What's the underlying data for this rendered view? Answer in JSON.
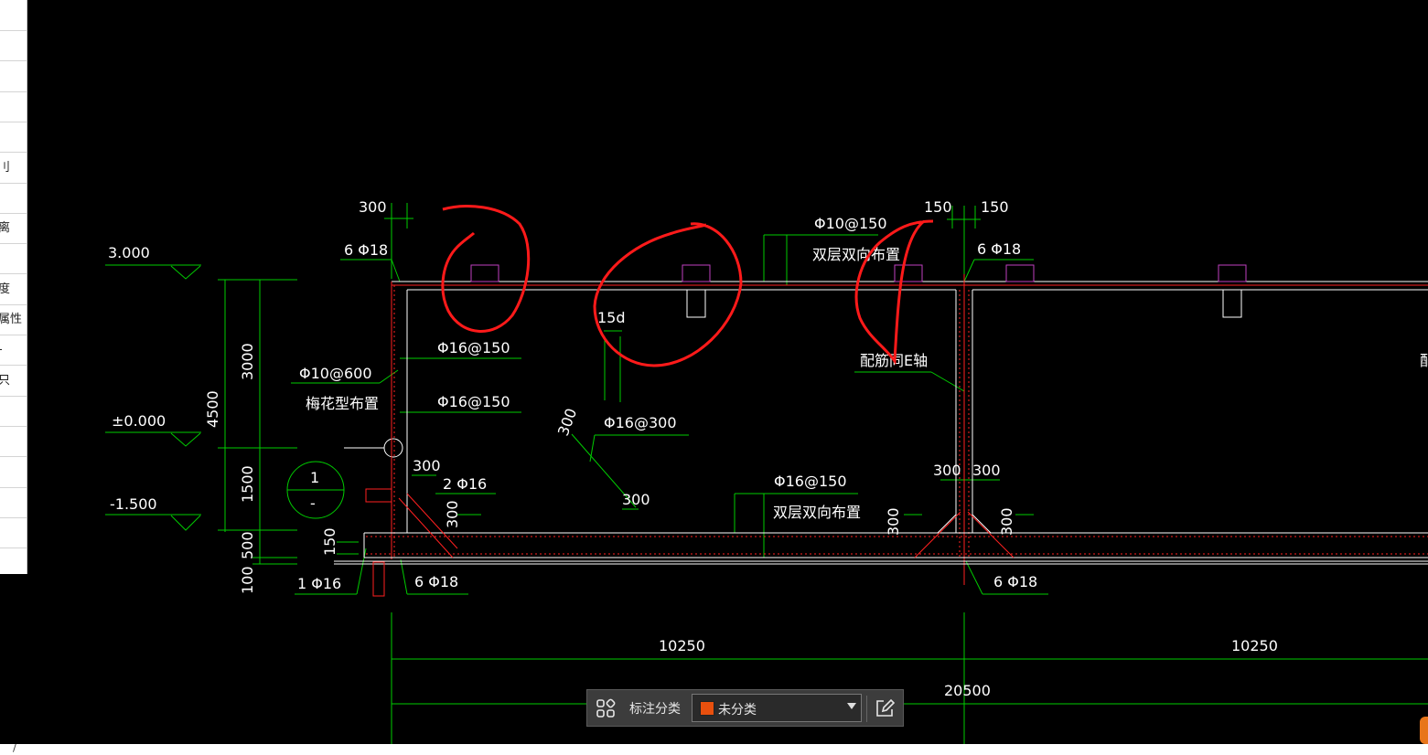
{
  "side_panel": {
    "items": [
      {
        "label": ""
      },
      {
        "label": ""
      },
      {
        "label": ""
      },
      {
        "label": ""
      },
      {
        "label": ""
      },
      {
        "label": "刂"
      },
      {
        "label": ""
      },
      {
        "label": "离"
      },
      {
        "label": ""
      },
      {
        "label": "度"
      },
      {
        "label": "属性"
      },
      {
        "label": "-"
      },
      {
        "label": "只"
      },
      {
        "label": ""
      },
      {
        "label": ""
      },
      {
        "label": ""
      },
      {
        "label": ""
      },
      {
        "label": ""
      }
    ]
  },
  "drawing": {
    "elev_top": "3.000",
    "elev_zero": "±0.000",
    "elev_bottom": "-1.500",
    "dim_4500": "4500",
    "dim_3000": "3000",
    "dim_1500": "1500",
    "dim_500": "500",
    "dim_100": "100",
    "dim_150_small": "150",
    "dim_300_top": "300",
    "rebar_6phi18_left": "6 Φ18",
    "rebar_phi10_600": "Φ10@600",
    "note_plum": "梅花型布置",
    "rebar_phi16_150_a": "Φ16@150",
    "rebar_phi16_150_b": "Φ16@150",
    "dim_300_wall": "300",
    "rebar_2phi16": "2 Φ16",
    "dim_300_haunch_left": "300",
    "rebar_1phi16": "1 Φ16",
    "rebar_6phi18_bottom_left": "6 Φ18",
    "section_num": "1",
    "section_dash": "-",
    "dim_15d": "15d",
    "dim_300_diag_a": "300",
    "dim_300_diag_b": "300",
    "rebar_phi16_300": "Φ16@300",
    "rebar_phi10_150": "Φ10@150",
    "note_double_top": "双层双向布置",
    "rebar_phi16_150_c": "Φ16@150",
    "note_double_bottom": "双层双向布置",
    "note_axis": "配筋同E轴",
    "note_axis_right": "配",
    "dim_150_a": "150",
    "dim_150_b": "150",
    "rebar_6phi18_right": "6 Φ18",
    "dim_300_mid_a": "300",
    "dim_300_mid_b": "300",
    "dim_300_haunch_a": "300",
    "dim_300_haunch_b": "300",
    "rebar_6phi18_bottom_right": "6 Φ18",
    "dim_10250_a": "10250",
    "dim_10250_b": "10250",
    "dim_20500": "20500"
  },
  "toolbar": {
    "grid_icon": "grid-icon",
    "label": "标注分类",
    "select_value": "未分类",
    "swatch_color": "#e8500e",
    "edit_icon": "edit-icon"
  },
  "statusbar": {
    "text": "/"
  },
  "colors": {
    "background": "#000000",
    "dimension": "#00cc00",
    "text": "#ffffff",
    "structure": "#ff2020",
    "markup": "#ff1a1a",
    "magenta": "#c040c0"
  }
}
